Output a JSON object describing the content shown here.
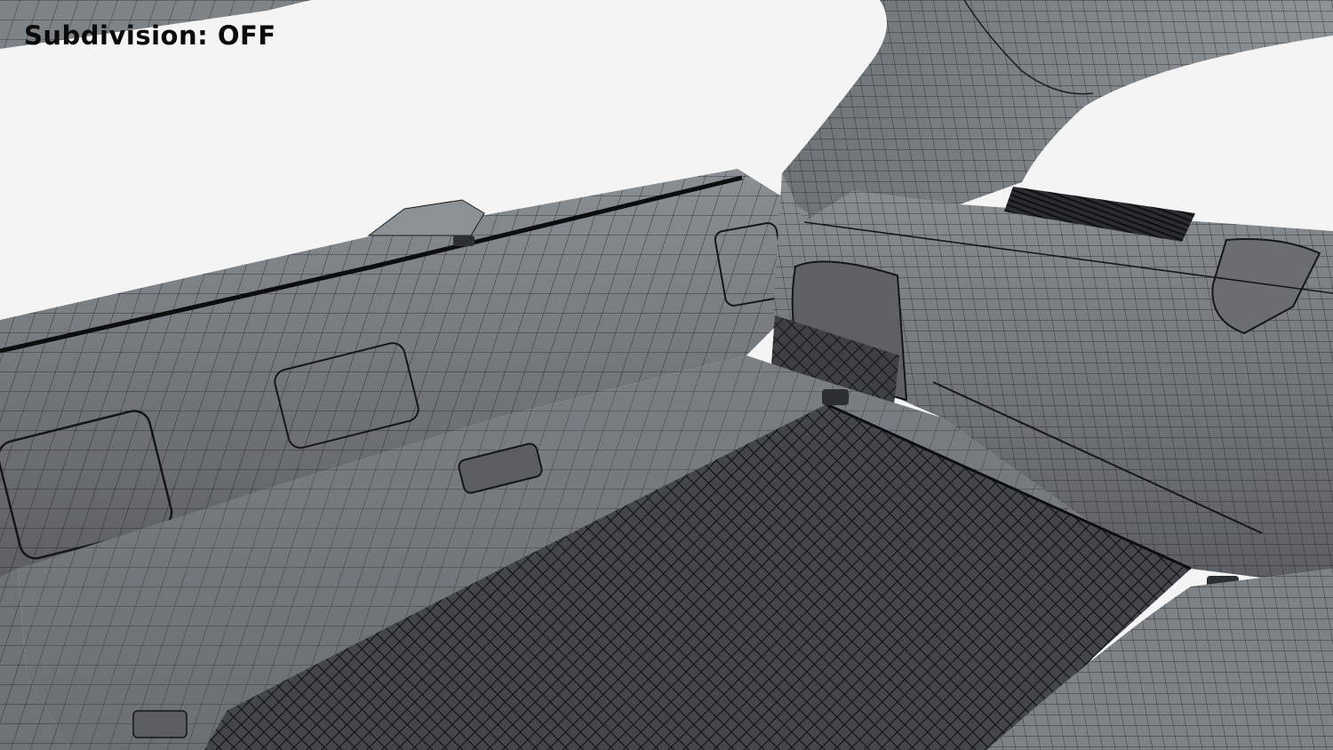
{
  "overlay": {
    "subdivision_label": "Subdivision:",
    "subdivision_value": "OFF"
  },
  "colors": {
    "background": "#f4f4f4",
    "surface_dark": "#4f5357",
    "surface_mid": "#6c7075",
    "surface_light": "#8f9499",
    "wire": "#141618",
    "label_text": "#0a0a0a"
  },
  "icons": [
    "wireframe-mesh",
    "cargo-net",
    "vent-grille",
    "tie-down-hook"
  ]
}
